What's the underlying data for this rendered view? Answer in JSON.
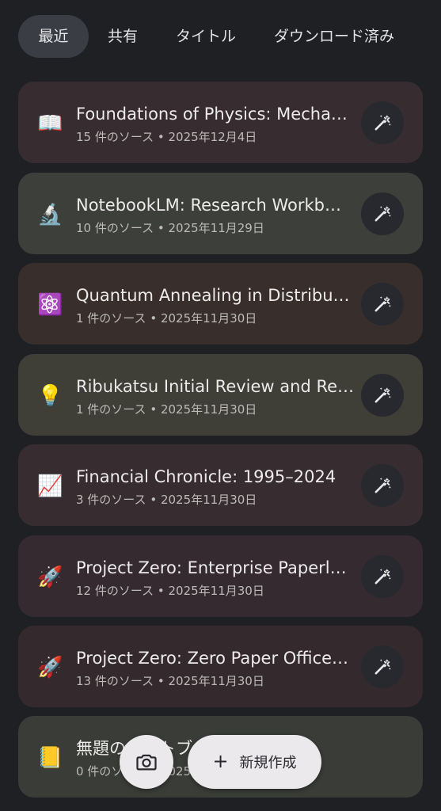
{
  "tabs": [
    {
      "label": "最近"
    },
    {
      "label": "共有"
    },
    {
      "label": "タイトル"
    },
    {
      "label": "ダウンロード済み"
    }
  ],
  "notebooks": [
    {
      "emoji": "📖",
      "title": "Foundations of Physics: Mecha…",
      "meta": "15 件のソース • 2025年12月4日"
    },
    {
      "emoji": "🔬",
      "title": "NotebookLM: Research Workb…",
      "meta": "10 件のソース • 2025年11月29日"
    },
    {
      "emoji": "⚛️",
      "title": "Quantum Annealing in Distribu…",
      "meta": "1 件のソース • 2025年11月30日"
    },
    {
      "emoji": "💡",
      "title": "Ribukatsu Initial Review and Re…",
      "meta": "1 件のソース • 2025年11月30日"
    },
    {
      "emoji": "📈",
      "title": "Financial Chronicle: 1995–2024",
      "meta": "3 件のソース • 2025年11月30日"
    },
    {
      "emoji": "🚀",
      "title": "Project Zero: Enterprise Paperl…",
      "meta": "12 件のソース • 2025年11月30日"
    },
    {
      "emoji": "🚀",
      "title": "Project Zero: Zero Paper Office…",
      "meta": "13 件のソース • 2025年11月30日"
    },
    {
      "emoji": "📒",
      "title": "無題のノートブ",
      "meta": "0 件のソース • 2025"
    }
  ],
  "fab": {
    "camera_icon": "camera-icon",
    "new_label": "新規作成",
    "plus": "+"
  },
  "colors": {
    "background": "#1f2024",
    "tab_active": "#3a3d44",
    "button_light": "#ece9ec"
  }
}
